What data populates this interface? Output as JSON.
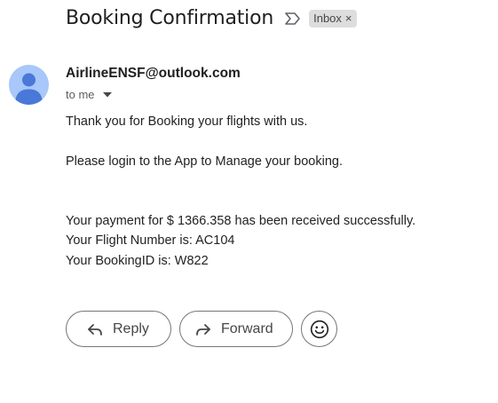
{
  "email": {
    "subject": "Booking Confirmation",
    "label": "Inbox",
    "label_close": "×",
    "sender": "AirlineENSF@outlook.com",
    "recipient": "to me",
    "body": {
      "line1": "Thank you for Booking your flights with us.",
      "line2": "Please login to the App to Manage your booking.",
      "line3": "Your payment for $ 1366.358 has been received successfully.",
      "line4": "Your Flight Number is: AC104",
      "line5": "Your BookingID is: W822"
    }
  },
  "actions": {
    "reply_label": "Reply",
    "forward_label": "Forward"
  },
  "icons": {
    "important": "important-marker-icon",
    "avatar": "person-avatar-icon",
    "caret": "caret-down-icon",
    "reply": "reply-arrow-icon",
    "forward": "forward-arrow-icon",
    "emoji": "smiley-emoji-icon"
  },
  "colors": {
    "avatar_bg": "#a8c7fa",
    "avatar_fg": "#4a78d8",
    "chip_bg": "#dddddd",
    "button_border": "#747775"
  }
}
